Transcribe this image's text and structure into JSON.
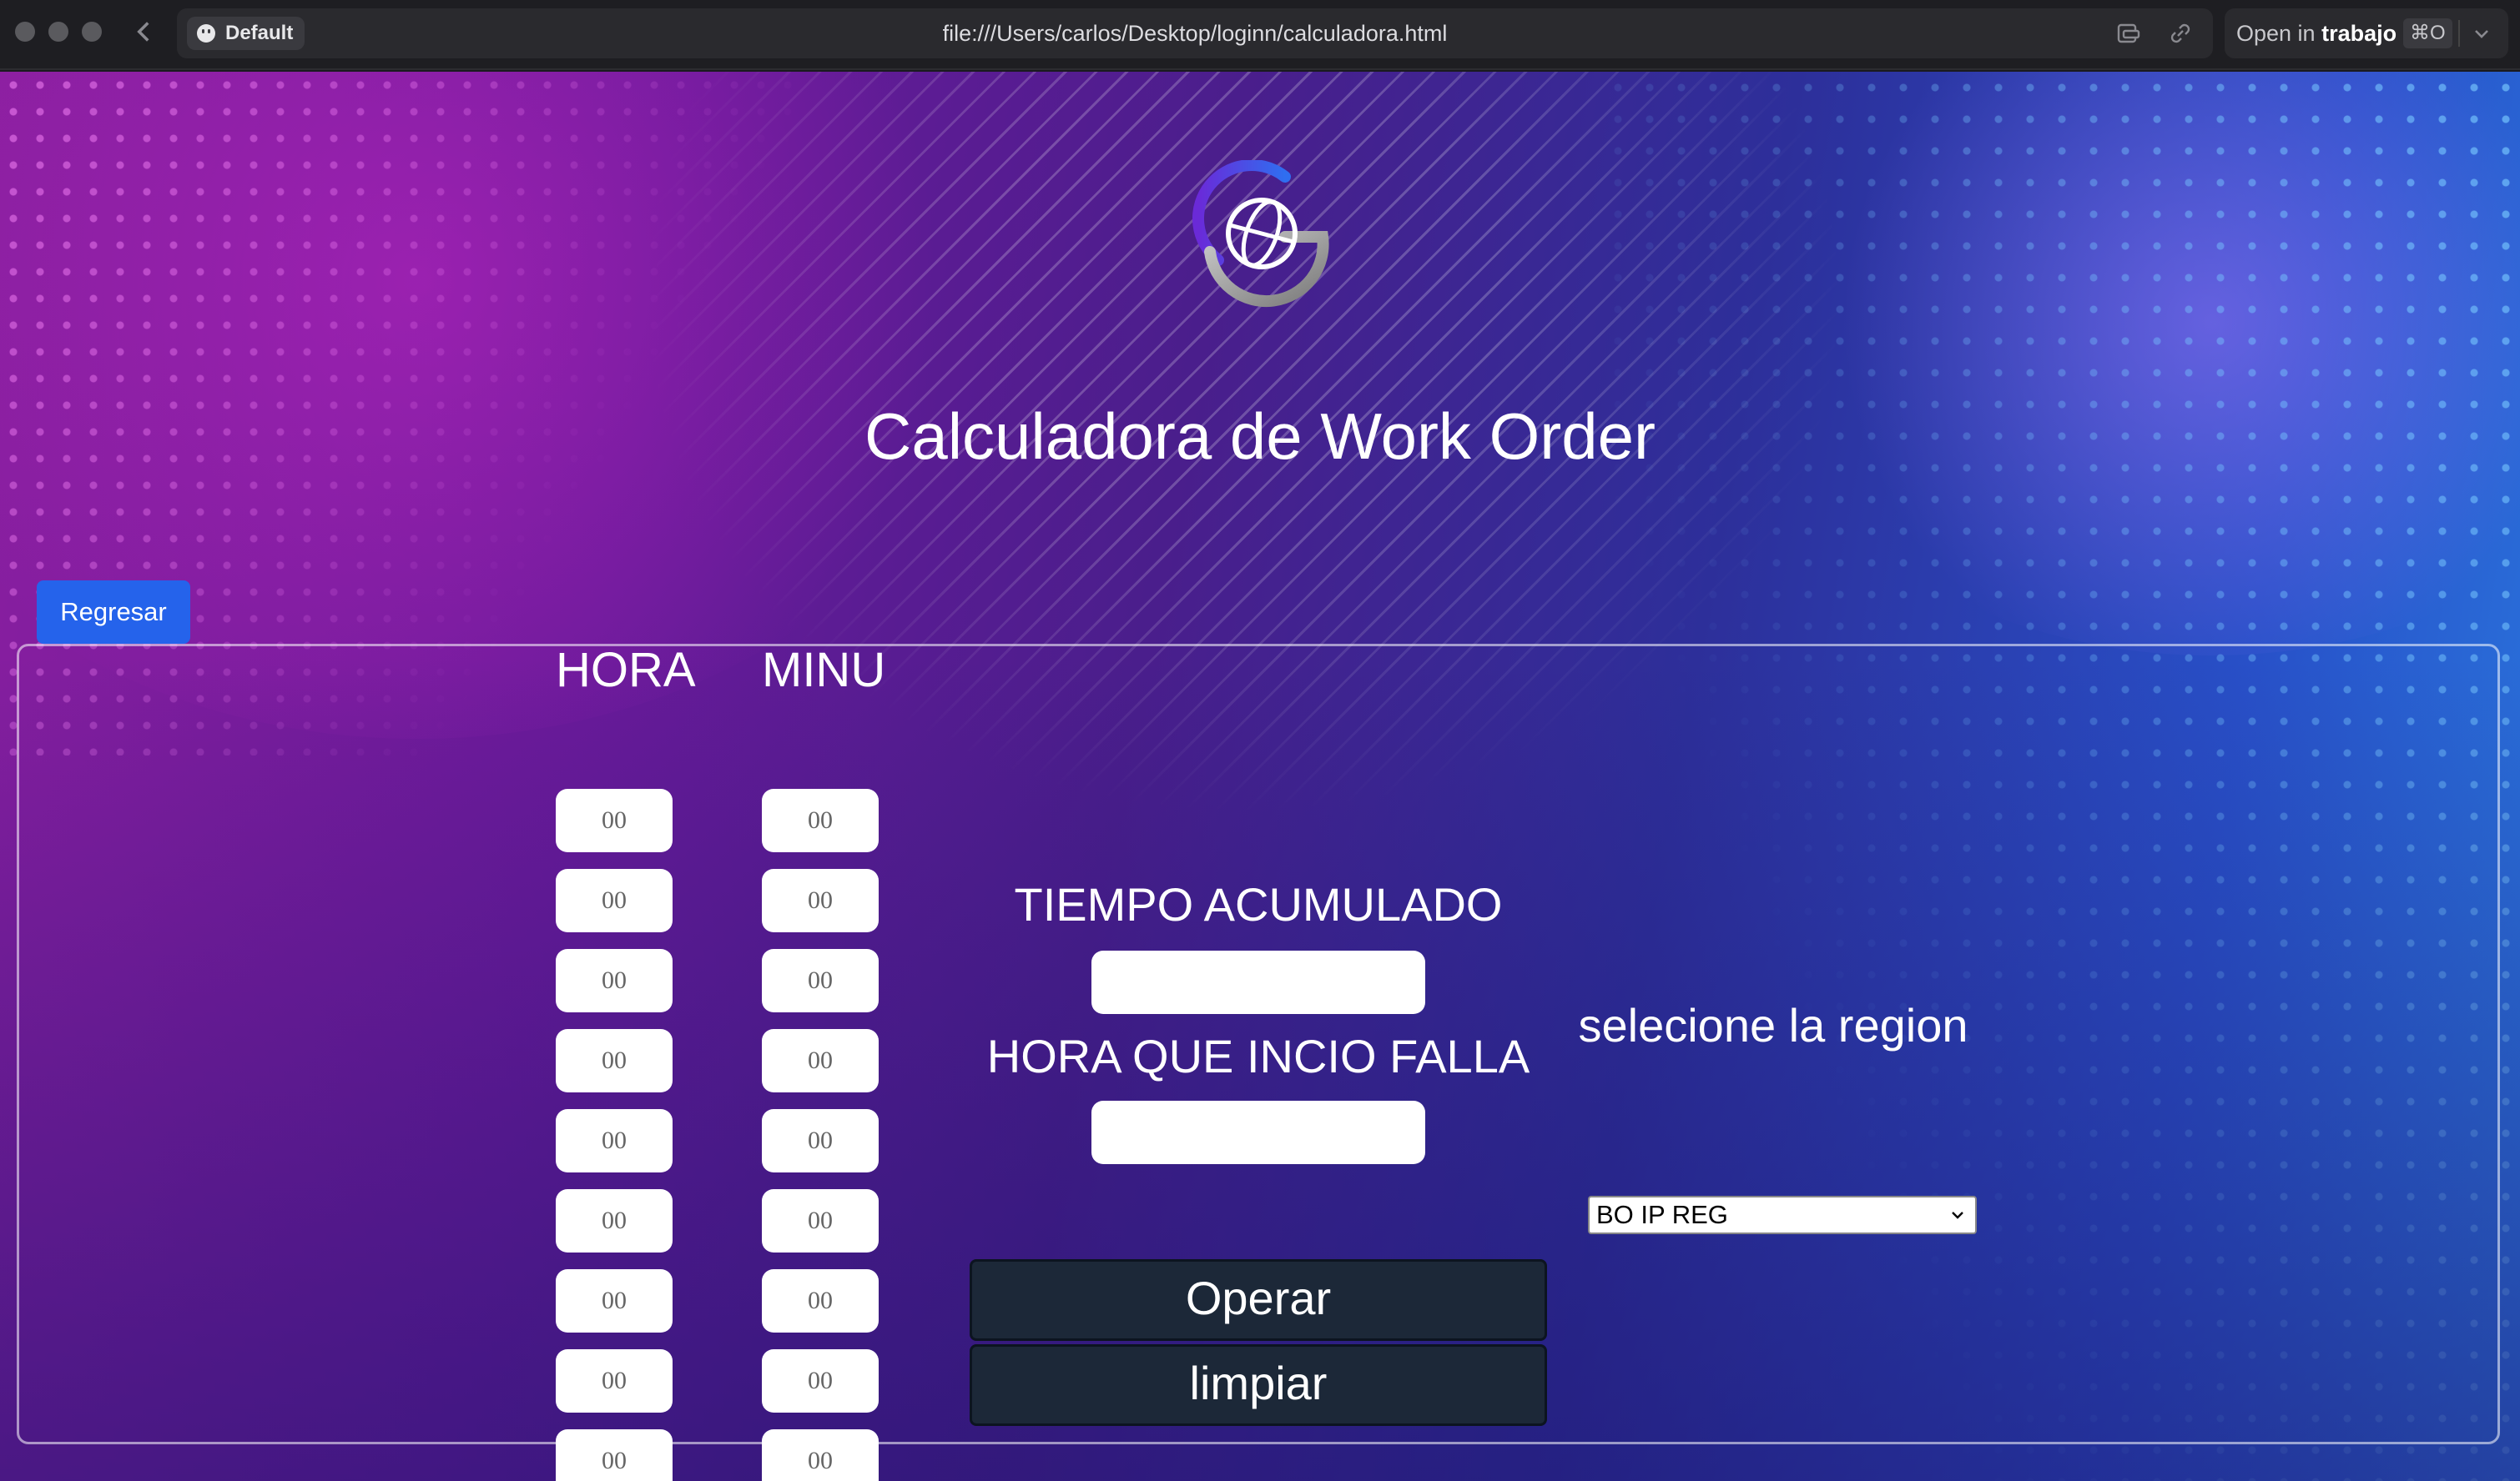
{
  "browser": {
    "profile": "Default",
    "url": "file:///Users/carlos/Desktop/loginn/calculadora.html",
    "open_in_label": "Open in",
    "open_in_target": "trabajo",
    "open_in_shortcut": "⌘O"
  },
  "page": {
    "title": "Calculadora de Work Order",
    "back_button": "Regresar",
    "hour_header": "HORA",
    "minute_header": "MINU",
    "hours": [
      "00",
      "00",
      "00",
      "00",
      "00",
      "00",
      "00",
      "00",
      "00"
    ],
    "minutes": [
      "00",
      "00",
      "00",
      "00",
      "00",
      "00",
      "00",
      "00",
      "00"
    ],
    "accumulated_label": "TIEMPO ACUMULADO",
    "start_label": "HORA QUE INCIO FALLA",
    "region_label": "selecione la region",
    "region_selected": "BO IP REG",
    "operate_button": "Operar",
    "clear_button": "limpiar"
  },
  "colors": {
    "back_button_bg": "#2563eb",
    "action_button_bg": "#1c2838"
  }
}
